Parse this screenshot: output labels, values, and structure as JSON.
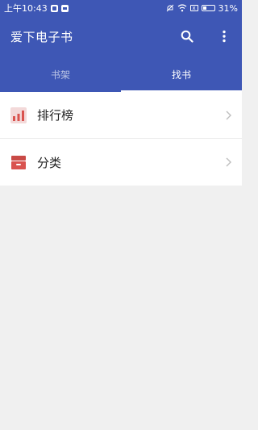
{
  "status_bar": {
    "time": "上午10:43",
    "battery": "31%",
    "sim_icon_text": "x"
  },
  "app": {
    "title": "爱下电子书"
  },
  "tabs": [
    {
      "label": "书架",
      "active": false
    },
    {
      "label": "找书",
      "active": true
    }
  ],
  "list": {
    "items": [
      {
        "label": "排行榜",
        "icon": "ranking-chart-icon"
      },
      {
        "label": "分类",
        "icon": "category-box-icon"
      }
    ]
  },
  "colors": {
    "primary": "#3e57b5",
    "background": "#f0f0f0",
    "icon_red": "#d9534f"
  }
}
